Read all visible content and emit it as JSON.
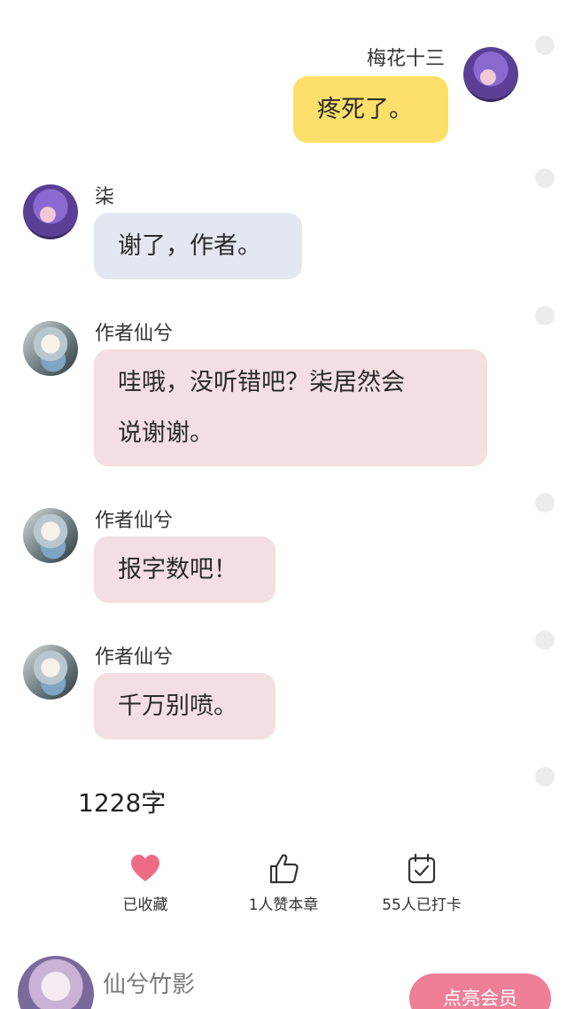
{
  "messages": [
    {
      "sender": "梅花十三",
      "text": "疼死了。"
    },
    {
      "sender": "柒",
      "text": "谢了，作者。"
    },
    {
      "sender": "作者仙兮",
      "text_line1": "哇哦，没听错吧？柒居然会",
      "text_line2": "说谢谢。"
    },
    {
      "sender": "作者仙兮",
      "text": "报字数吧！"
    },
    {
      "sender": "作者仙兮",
      "text": "千万别喷。"
    }
  ],
  "word_count": "1228字",
  "actions": {
    "collect_label": "已收藏",
    "like_label": "1人赞本章",
    "checkin_label": "55人已打卡"
  },
  "author": {
    "name": "仙兮竹影",
    "member_button": "点亮会员"
  },
  "colors": {
    "yellow_bubble": "#fde06b",
    "blue_bubble": "#e2e7f0",
    "pink_bubble": "#f3dfe1",
    "heart": "#ee6b86",
    "member_button": "#ef7f97"
  },
  "icons": [
    "heart-icon",
    "thumbs-up-icon",
    "calendar-check-icon"
  ]
}
